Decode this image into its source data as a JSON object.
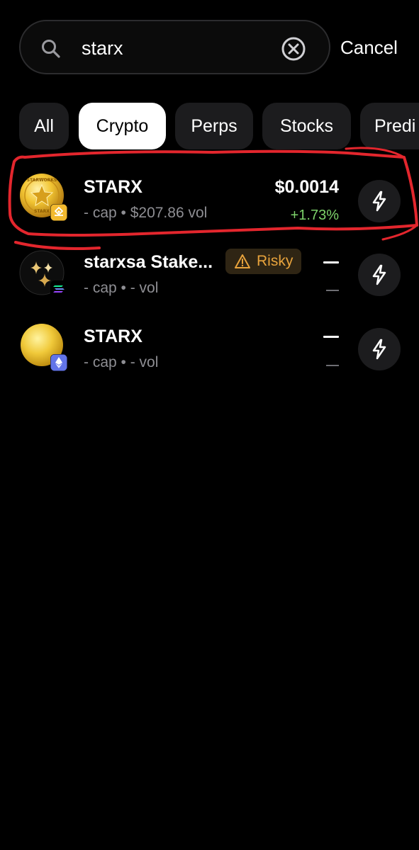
{
  "search": {
    "query": "starx",
    "cancel_label": "Cancel"
  },
  "tabs": [
    {
      "label": "All",
      "active": false
    },
    {
      "label": "Crypto",
      "active": true
    },
    {
      "label": "Perps",
      "active": false
    },
    {
      "label": "Stocks",
      "active": false
    },
    {
      "label": "Predi",
      "active": false
    }
  ],
  "results": [
    {
      "name": "STARX",
      "subtitle": "- cap • $207.86 vol",
      "price": "$0.0014",
      "change": "+1.73%",
      "chain_icon": "bnb-chain-icon",
      "logo_text_top": "STARWORKS",
      "logo_text_bottom": "STARX"
    },
    {
      "name": "starxsa Stake...",
      "subtitle": "- cap • - vol",
      "badge": "Risky",
      "chain_icon": "solana-chain-icon"
    },
    {
      "name": "STARX",
      "subtitle": "- cap • - vol",
      "chain_icon": "ethereum-chain-icon"
    }
  ],
  "colors": {
    "background": "#000000",
    "positive": "#7ed36b",
    "risky": "#e8a33c",
    "annotation": "#e3262d"
  }
}
